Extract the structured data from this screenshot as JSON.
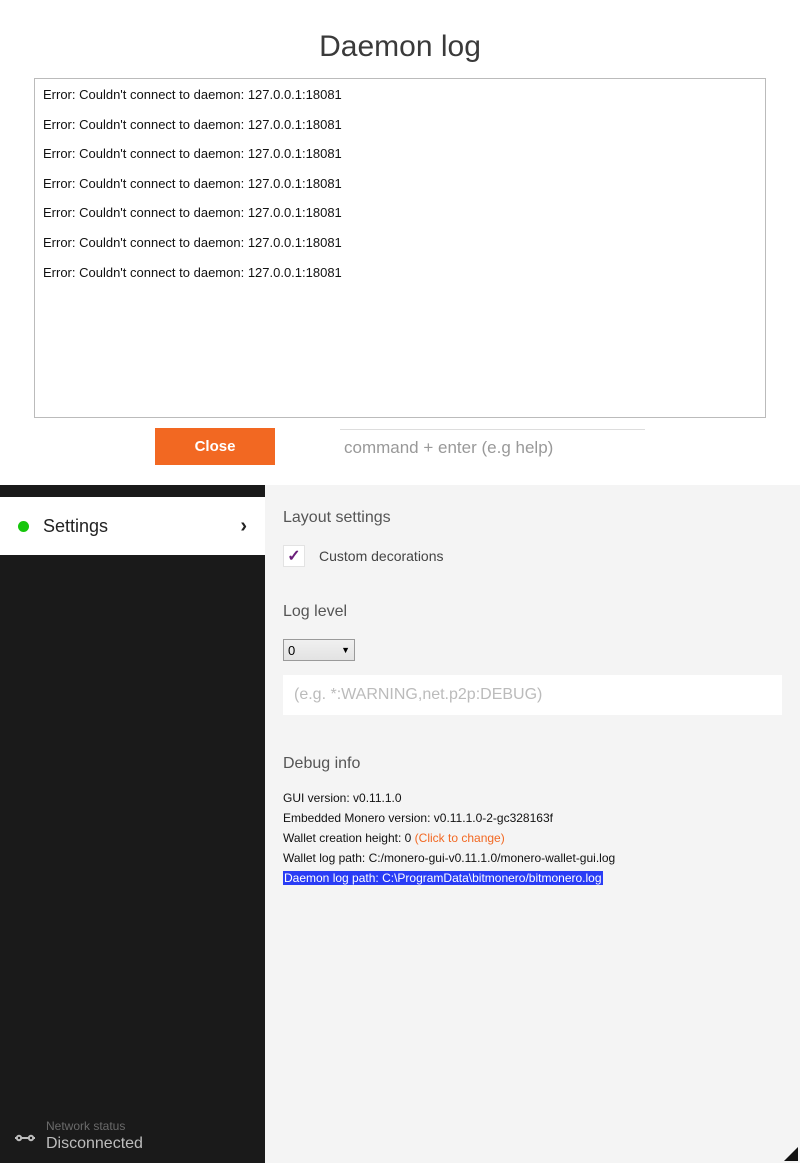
{
  "modal": {
    "title": "Daemon log",
    "log_lines": [
      "Error: Couldn't connect to daemon: 127.0.0.1:18081",
      "Error: Couldn't connect to daemon: 127.0.0.1:18081",
      "Error: Couldn't connect to daemon: 127.0.0.1:18081",
      "Error: Couldn't connect to daemon: 127.0.0.1:18081",
      "Error: Couldn't connect to daemon: 127.0.0.1:18081",
      "Error: Couldn't connect to daemon: 127.0.0.1:18081",
      "Error: Couldn't connect to daemon: 127.0.0.1:18081"
    ],
    "close_label": "Close",
    "command_placeholder": "command + enter (e.g help)"
  },
  "sidebar": {
    "items": [
      {
        "label": "Settings",
        "status": "green"
      }
    ],
    "network": {
      "label": "Network status",
      "value": "Disconnected"
    }
  },
  "settings": {
    "layout": {
      "heading": "Layout settings",
      "custom_decorations_label": "Custom decorations",
      "custom_decorations_checked": true
    },
    "log": {
      "heading": "Log level",
      "level_value": "0",
      "filter_placeholder": "(e.g. *:WARNING,net.p2p:DEBUG)"
    },
    "debug": {
      "heading": "Debug info",
      "gui_version_label": "GUI version:",
      "gui_version_value": "v0.11.1.0",
      "embedded_label": "Embedded Monero version:",
      "embedded_value": "v0.11.1.0-2-gc328163f",
      "creation_height_label": "Wallet creation height:",
      "creation_height_value": "0",
      "creation_height_action": "(Click to change)",
      "wallet_log_label": "Wallet log path:",
      "wallet_log_value": "C:/monero-gui-v0.11.1.0/monero-wallet-gui.log",
      "daemon_log_label": "Daemon log path:",
      "daemon_log_value": "C:\\ProgramData\\bitmonero/bitmonero.log"
    }
  }
}
